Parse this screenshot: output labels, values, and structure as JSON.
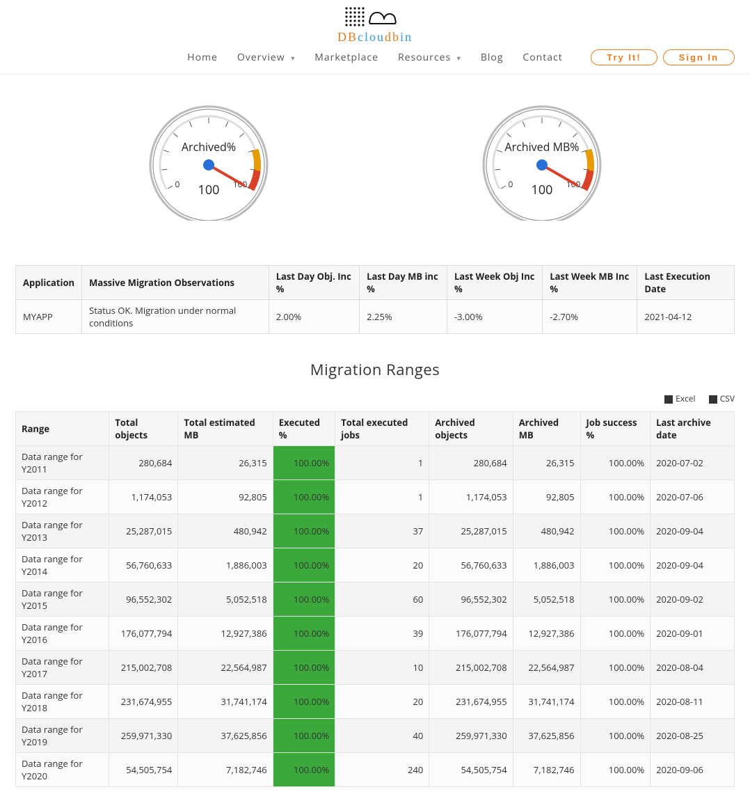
{
  "logo": {
    "top_symbol": "⠿⠿⠿ ⊂⊃",
    "db": "DB",
    "clou": "clou",
    "dmid": "db",
    "in": "in"
  },
  "nav": {
    "items": [
      {
        "label": "Home"
      },
      {
        "label": "Overview",
        "has_sub": true
      },
      {
        "label": "Marketplace"
      },
      {
        "label": "Resources",
        "has_sub": true
      },
      {
        "label": "Blog"
      },
      {
        "label": "Contact"
      }
    ],
    "try_it": "Try It!",
    "sign_in": "Sign In"
  },
  "chart_data": [
    {
      "type": "gauge",
      "title": "Archived%",
      "value": 100,
      "min": 0,
      "max": 100,
      "ticks": [
        "0",
        "100"
      ],
      "center_label": "100",
      "danger_start": 80
    },
    {
      "type": "gauge",
      "title": "Archived MB%",
      "value": 100,
      "min": 0,
      "max": 100,
      "ticks": [
        "0",
        "100"
      ],
      "center_label": "100",
      "danger_start": 80
    }
  ],
  "obs": {
    "headers": [
      "Application",
      "Massive Migration Observations",
      "Last Day Obj. Inc %",
      "Last Day MB inc %",
      "Last Week Obj Inc %",
      "Last Week MB Inc %",
      "Last Execution Date"
    ],
    "row": {
      "application": "MYAPP",
      "observations": "Status OK. Migration under normal conditions",
      "last_day_obj": "2.00%",
      "last_day_mb": "2.25%",
      "last_week_obj": "-3.00%",
      "last_week_mb": "-2.70%",
      "last_exec": "2021-04-12"
    }
  },
  "section_title": "Migration Ranges",
  "export": {
    "excel": "Excel",
    "csv": "CSV"
  },
  "ranges": {
    "headers": [
      "Range",
      "Total objects",
      "Total estimated MB",
      "Executed %",
      "Total executed jobs",
      "Archived objects",
      "Archived MB",
      "Job success %",
      "Last archive date"
    ],
    "rows": [
      {
        "range": "Data range for Y2011",
        "total_obj": "280,684",
        "total_mb": "26,315",
        "exec_pct": "100.00%",
        "exec_jobs": "1",
        "arch_obj": "280,684",
        "arch_mb": "26,315",
        "succ": "100.00%",
        "last": "2020-07-02"
      },
      {
        "range": "Data range for Y2012",
        "total_obj": "1,174,053",
        "total_mb": "92,805",
        "exec_pct": "100.00%",
        "exec_jobs": "1",
        "arch_obj": "1,174,053",
        "arch_mb": "92,805",
        "succ": "100.00%",
        "last": "2020-07-06"
      },
      {
        "range": "Data range for Y2013",
        "total_obj": "25,287,015",
        "total_mb": "480,942",
        "exec_pct": "100.00%",
        "exec_jobs": "37",
        "arch_obj": "25,287,015",
        "arch_mb": "480,942",
        "succ": "100.00%",
        "last": "2020-09-04"
      },
      {
        "range": "Data range for Y2014",
        "total_obj": "56,760,633",
        "total_mb": "1,886,003",
        "exec_pct": "100.00%",
        "exec_jobs": "20",
        "arch_obj": "56,760,633",
        "arch_mb": "1,886,003",
        "succ": "100.00%",
        "last": "2020-09-04"
      },
      {
        "range": "Data range for Y2015",
        "total_obj": "96,552,302",
        "total_mb": "5,052,518",
        "exec_pct": "100.00%",
        "exec_jobs": "60",
        "arch_obj": "96,552,302",
        "arch_mb": "5,052,518",
        "succ": "100.00%",
        "last": "2020-09-02"
      },
      {
        "range": "Data range for Y2016",
        "total_obj": "176,077,794",
        "total_mb": "12,927,386",
        "exec_pct": "100.00%",
        "exec_jobs": "39",
        "arch_obj": "176,077,794",
        "arch_mb": "12,927,386",
        "succ": "100.00%",
        "last": "2020-09-01"
      },
      {
        "range": "Data range for Y2017",
        "total_obj": "215,002,708",
        "total_mb": "22,564,987",
        "exec_pct": "100.00%",
        "exec_jobs": "10",
        "arch_obj": "215,002,708",
        "arch_mb": "22,564,987",
        "succ": "100.00%",
        "last": "2020-08-04"
      },
      {
        "range": "Data range for Y2018",
        "total_obj": "231,674,955",
        "total_mb": "31,741,174",
        "exec_pct": "100.00%",
        "exec_jobs": "20",
        "arch_obj": "231,674,955",
        "arch_mb": "31,741,174",
        "succ": "100.00%",
        "last": "2020-08-11"
      },
      {
        "range": "Data range for Y2019",
        "total_obj": "259,971,330",
        "total_mb": "37,625,856",
        "exec_pct": "100.00%",
        "exec_jobs": "40",
        "arch_obj": "259,971,330",
        "arch_mb": "37,625,856",
        "succ": "100.00%",
        "last": "2020-08-25"
      },
      {
        "range": "Data range for Y2020",
        "total_obj": "54,505,754",
        "total_mb": "7,182,746",
        "exec_pct": "100.00%",
        "exec_jobs": "240",
        "arch_obj": "54,505,754",
        "arch_mb": "7,182,746",
        "succ": "100.00%",
        "last": "2020-09-06"
      }
    ]
  }
}
